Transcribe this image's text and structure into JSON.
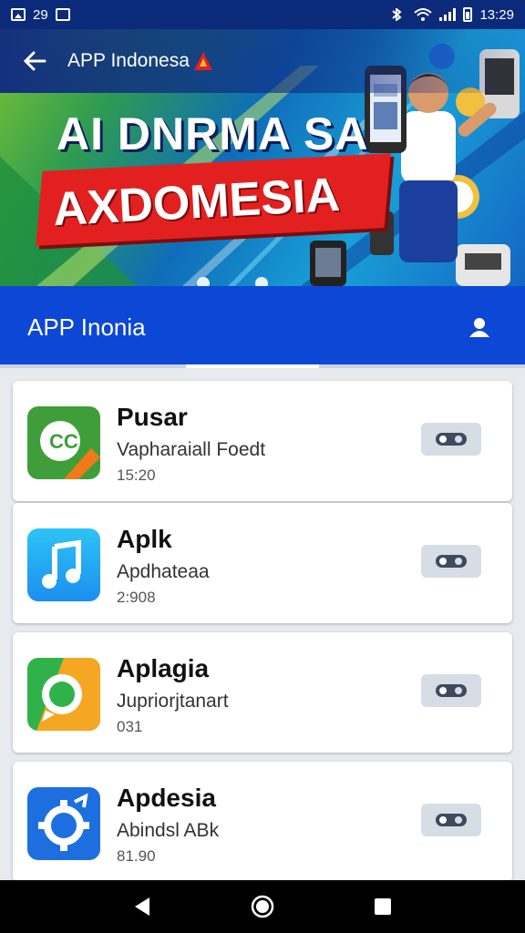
{
  "status_bar": {
    "left_text": "29",
    "time": "13:29"
  },
  "banner": {
    "app_title": "APP Indonesa",
    "headline_line1": "AI DNRMA SA",
    "headline_line2": "AXDOMESIA"
  },
  "section": {
    "title": "APP Inonia"
  },
  "apps": [
    {
      "name": "Pusar",
      "subtitle": "Vapharaiall Foedt",
      "meta": "15:20",
      "icon": "chat-code-icon"
    },
    {
      "name": "Aplk",
      "subtitle": "Apdhateaa",
      "meta": "2:908",
      "icon": "music-note-icon"
    },
    {
      "name": "Aplagia",
      "subtitle": "Jupriorjtanart",
      "meta": "031",
      "icon": "chat-bubble-icon"
    },
    {
      "name": "Apdesia",
      "subtitle": "Abindsl ABk",
      "meta": "81.90",
      "icon": "gear-settings-icon"
    }
  ],
  "colors": {
    "header_blue": "#0d47d6",
    "status_navy": "#0b2a7a",
    "banner_red": "#e32020",
    "card_bg": "#ffffff",
    "toggle_bg": "#d7dde5"
  }
}
